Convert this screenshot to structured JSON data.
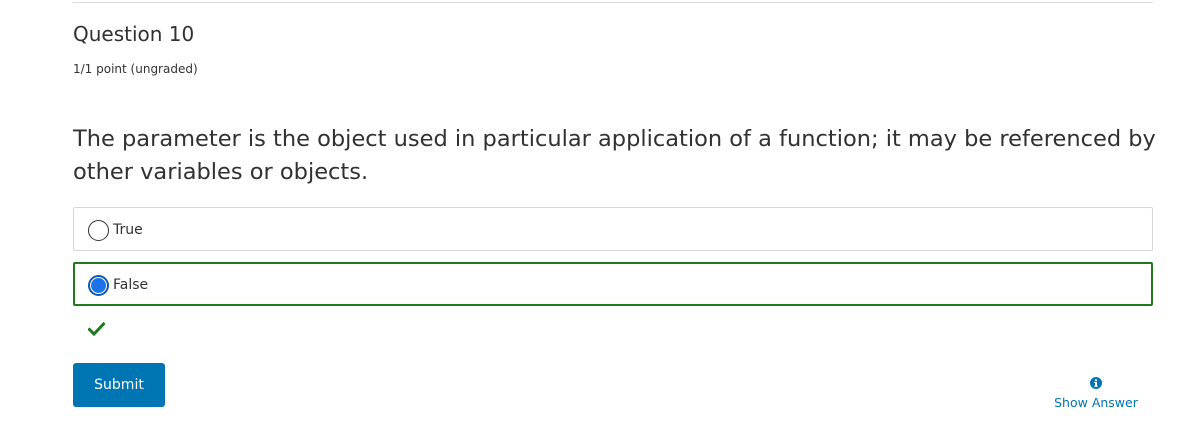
{
  "problem": {
    "title": "Question 10",
    "points": "1/1 point (ungraded)",
    "question": "The parameter is the object used in particular application of a function; it may be referenced by other variables or objects."
  },
  "choices": [
    {
      "label": "True",
      "selected": false
    },
    {
      "label": "False",
      "selected": true,
      "status": "correct"
    }
  ],
  "feedback": {
    "icon": "checkmark-icon",
    "color": "#1f7a1f"
  },
  "actions": {
    "submit_label": "Submit",
    "show_answer_label": "Show Answer",
    "show_answer_icon": "info-icon"
  },
  "colors": {
    "accent": "#0075b4",
    "correct": "#1f7a1f",
    "radio_fill": "#1a73e8"
  }
}
